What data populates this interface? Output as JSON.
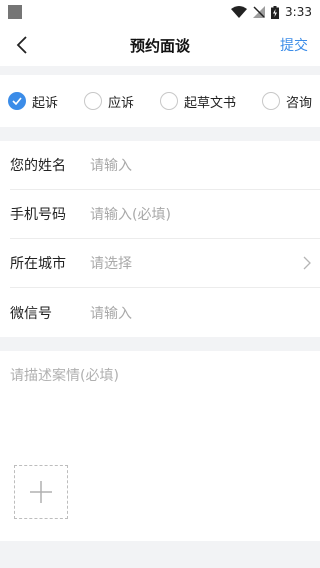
{
  "status_bar": {
    "time": "3:33"
  },
  "header": {
    "title": "预约面谈",
    "submit_label": "提交"
  },
  "case_types": [
    {
      "label": "起诉",
      "checked": true
    },
    {
      "label": "应诉",
      "checked": false
    },
    {
      "label": "起草文书",
      "checked": false
    },
    {
      "label": "咨询",
      "checked": false
    }
  ],
  "form": {
    "name": {
      "label": "您的姓名",
      "placeholder": "请输入"
    },
    "phone": {
      "label": "手机号码",
      "placeholder": "请输入(必填)"
    },
    "city": {
      "label": "所在城市",
      "placeholder": "请选择"
    },
    "wechat": {
      "label": "微信号",
      "placeholder": "请输入"
    }
  },
  "description": {
    "placeholder": "请描述案情(必填)"
  },
  "colors": {
    "accent": "#3b8ce8",
    "background": "#f2f3f5"
  }
}
